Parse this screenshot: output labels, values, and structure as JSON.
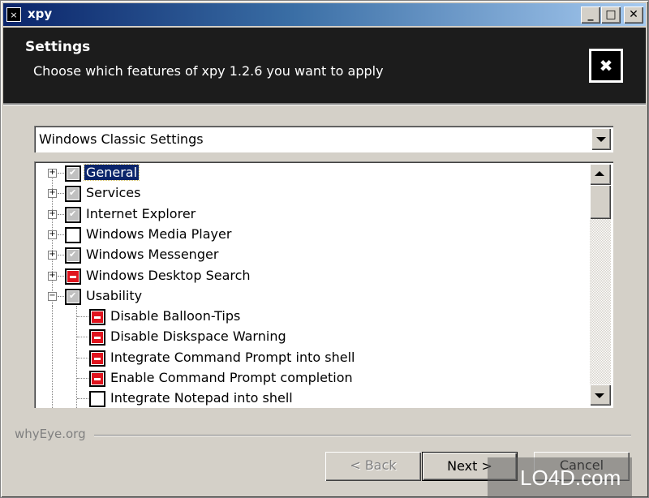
{
  "window": {
    "title": "xpy",
    "controls": {
      "minimize": "_",
      "maximize": "□",
      "close": "✕"
    }
  },
  "header": {
    "title": "Settings",
    "subtitle": "Choose which features of xpy 1.2.6 you want to apply",
    "icon": "✖"
  },
  "profile_select": {
    "selected": "Windows Classic Settings"
  },
  "tree": {
    "items": [
      {
        "label": "General",
        "state": "partial",
        "expander": "+",
        "level": 0,
        "selected": true
      },
      {
        "label": "Services",
        "state": "partial",
        "expander": "+",
        "level": 0
      },
      {
        "label": "Internet Explorer",
        "state": "partial",
        "expander": "+",
        "level": 0
      },
      {
        "label": "Windows Media Player",
        "state": "unchecked",
        "expander": "+",
        "level": 0
      },
      {
        "label": "Windows Messenger",
        "state": "partial",
        "expander": "+",
        "level": 0
      },
      {
        "label": "Windows Desktop Search",
        "state": "disabled-red",
        "expander": "+",
        "level": 0
      },
      {
        "label": "Usability",
        "state": "partial",
        "expander": "−",
        "level": 0
      },
      {
        "label": "Disable Balloon-Tips",
        "state": "disabled-red",
        "level": 1
      },
      {
        "label": "Disable Diskspace Warning",
        "state": "disabled-red",
        "level": 1
      },
      {
        "label": "Integrate Command Prompt into shell",
        "state": "disabled-red",
        "level": 1
      },
      {
        "label": "Enable Command Prompt completion",
        "state": "disabled-red",
        "level": 1
      },
      {
        "label": "Integrate Notepad into shell",
        "state": "unchecked",
        "level": 1
      }
    ]
  },
  "footer": {
    "brand": "whyEye.org",
    "back_label": "< Back",
    "next_label": "Next >",
    "cancel_label": "Cancel"
  },
  "watermark": {
    "text": "LO4D.com"
  }
}
